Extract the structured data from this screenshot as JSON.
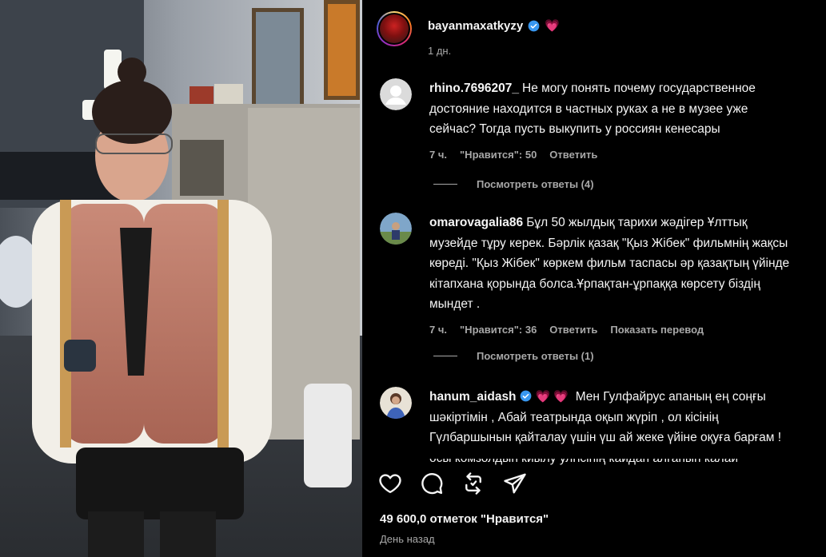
{
  "post": {
    "username": "bayanmaxatkyzy",
    "emoji": "💗",
    "time": "1 дн.",
    "likes": "49 600,0 отметок \"Нравится\"",
    "date": "День назад"
  },
  "comments": [
    {
      "username": "rhino.7696207_",
      "text": "Не могу понять почему государственное достояние находится в частных руках а не в музее уже сейчас? Тогда пусть выкупить у россиян кенесары",
      "time": "7 ч.",
      "likes": "\"Нравится\": 50",
      "reply": "Ответить",
      "view_replies": "Посмотреть ответы (4)",
      "avatar": "default-avatar"
    },
    {
      "username": "omarovagalia86",
      "text": "Бұл 50 жылдық тарихи жәдігер Ұлттық музейде тұру керек. Бәрлік қазақ \"Қыз Жібек\" фильмнің жақсы көреді. \"Қыз Жібек\" көркем фильм таспасы әр қазақтың үйінде кітапхана қорында болса.Ұрпақтан-ұрпаққа көрсету біздің мындет .",
      "time": "7 ч.",
      "likes": "\"Нравится\": 36",
      "reply": "Ответить",
      "translate": "Показать перевод",
      "view_replies": "Посмотреть ответы (1)",
      "avatar": "photo-avatar"
    },
    {
      "username": "hanum_aidash",
      "emoji": "💗 💗",
      "text": "Мен Гулфайрус апаның ең соңғы шәкіртімін , Абай театрында оқып жүріп , ол кісінің Гүлбаршынын қайталау үшін үш ай жеке үйіне оқуға барғам ! осы комзолдын киылу улгісінің кайдан алғанын калай",
      "avatar": "photo-avatar"
    }
  ],
  "icons": {
    "like": "heart-icon",
    "comment": "comment-icon",
    "repost": "repost-icon",
    "share": "send-icon"
  },
  "colors": {
    "background": "#000000",
    "text": "#f5f5f5",
    "secondary": "#a8a8a8",
    "verified": "#3897f0",
    "heart": "#ff3a6e"
  }
}
